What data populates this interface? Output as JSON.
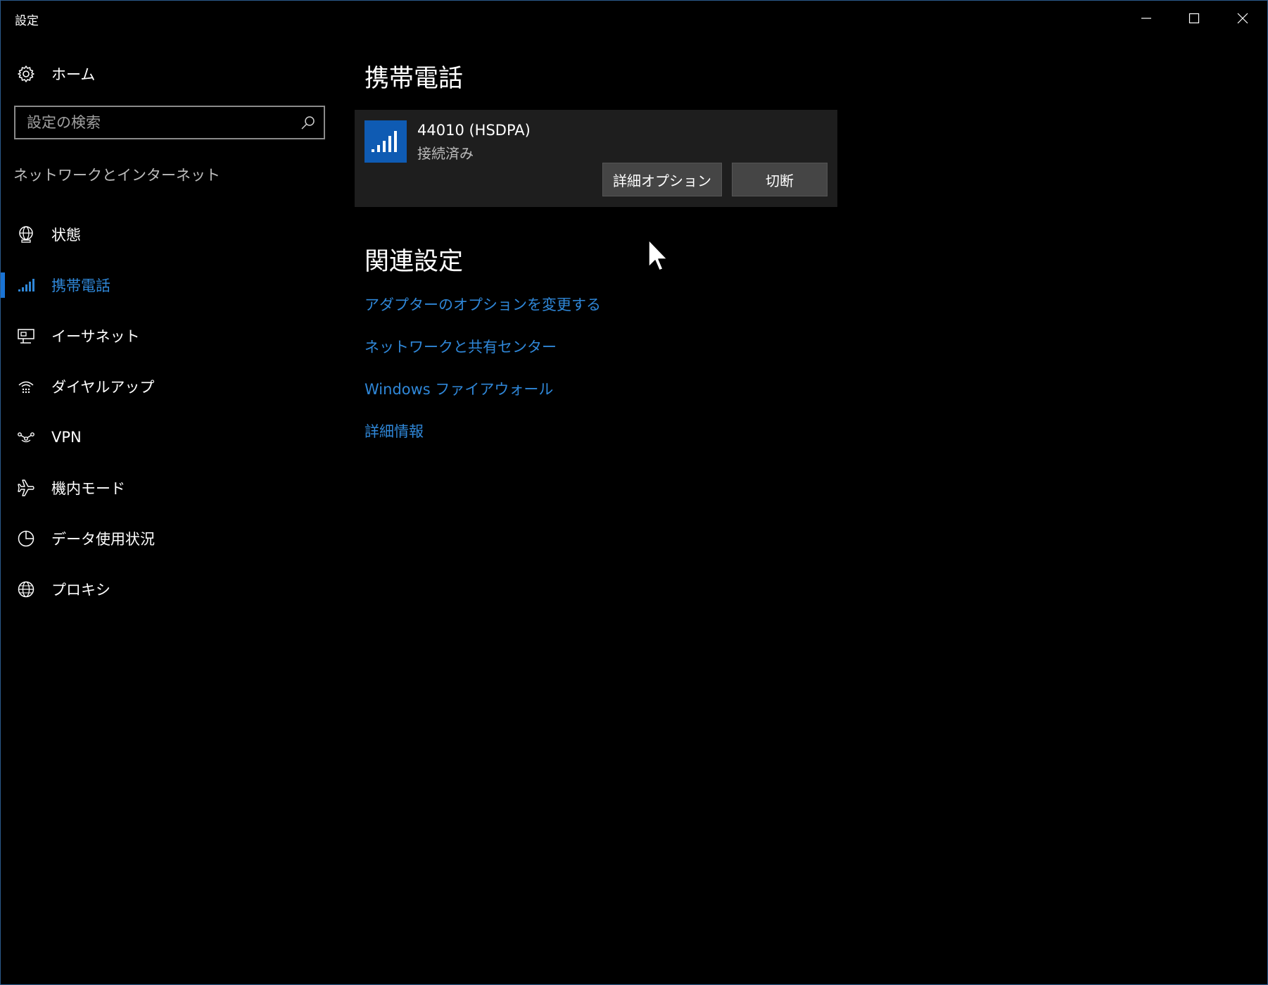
{
  "window": {
    "title": "設定",
    "accent_color": "#1a73d4",
    "link_color": "#2f87d8"
  },
  "titlebar_buttons": {
    "minimize_icon": "minimize-icon",
    "maximize_icon": "maximize-icon",
    "close_icon": "close-icon"
  },
  "sidebar": {
    "home_label": "ホーム",
    "search_placeholder": "設定の検索",
    "section_title": "ネットワークとインターネット",
    "items": [
      {
        "label": "状態",
        "icon": "globe-status-icon"
      },
      {
        "label": "携帯電話",
        "icon": "cellular-signal-icon",
        "active": true
      },
      {
        "label": "イーサネット",
        "icon": "ethernet-icon"
      },
      {
        "label": "ダイヤルアップ",
        "icon": "dialup-icon"
      },
      {
        "label": "VPN",
        "icon": "vpn-icon"
      },
      {
        "label": "機内モード",
        "icon": "airplane-icon"
      },
      {
        "label": "データ使用状況",
        "icon": "data-usage-icon"
      },
      {
        "label": "プロキシ",
        "icon": "globe-icon"
      }
    ]
  },
  "main": {
    "title": "携帯電話",
    "connection": {
      "name": "44010 (HSDPA)",
      "status": "接続済み",
      "advanced_button": "詳細オプション",
      "disconnect_button": "切断"
    },
    "related": {
      "title": "関連設定",
      "links": [
        "アダプターのオプションを変更する",
        "ネットワークと共有センター",
        "Windows ファイアウォール",
        "詳細情報"
      ]
    }
  }
}
